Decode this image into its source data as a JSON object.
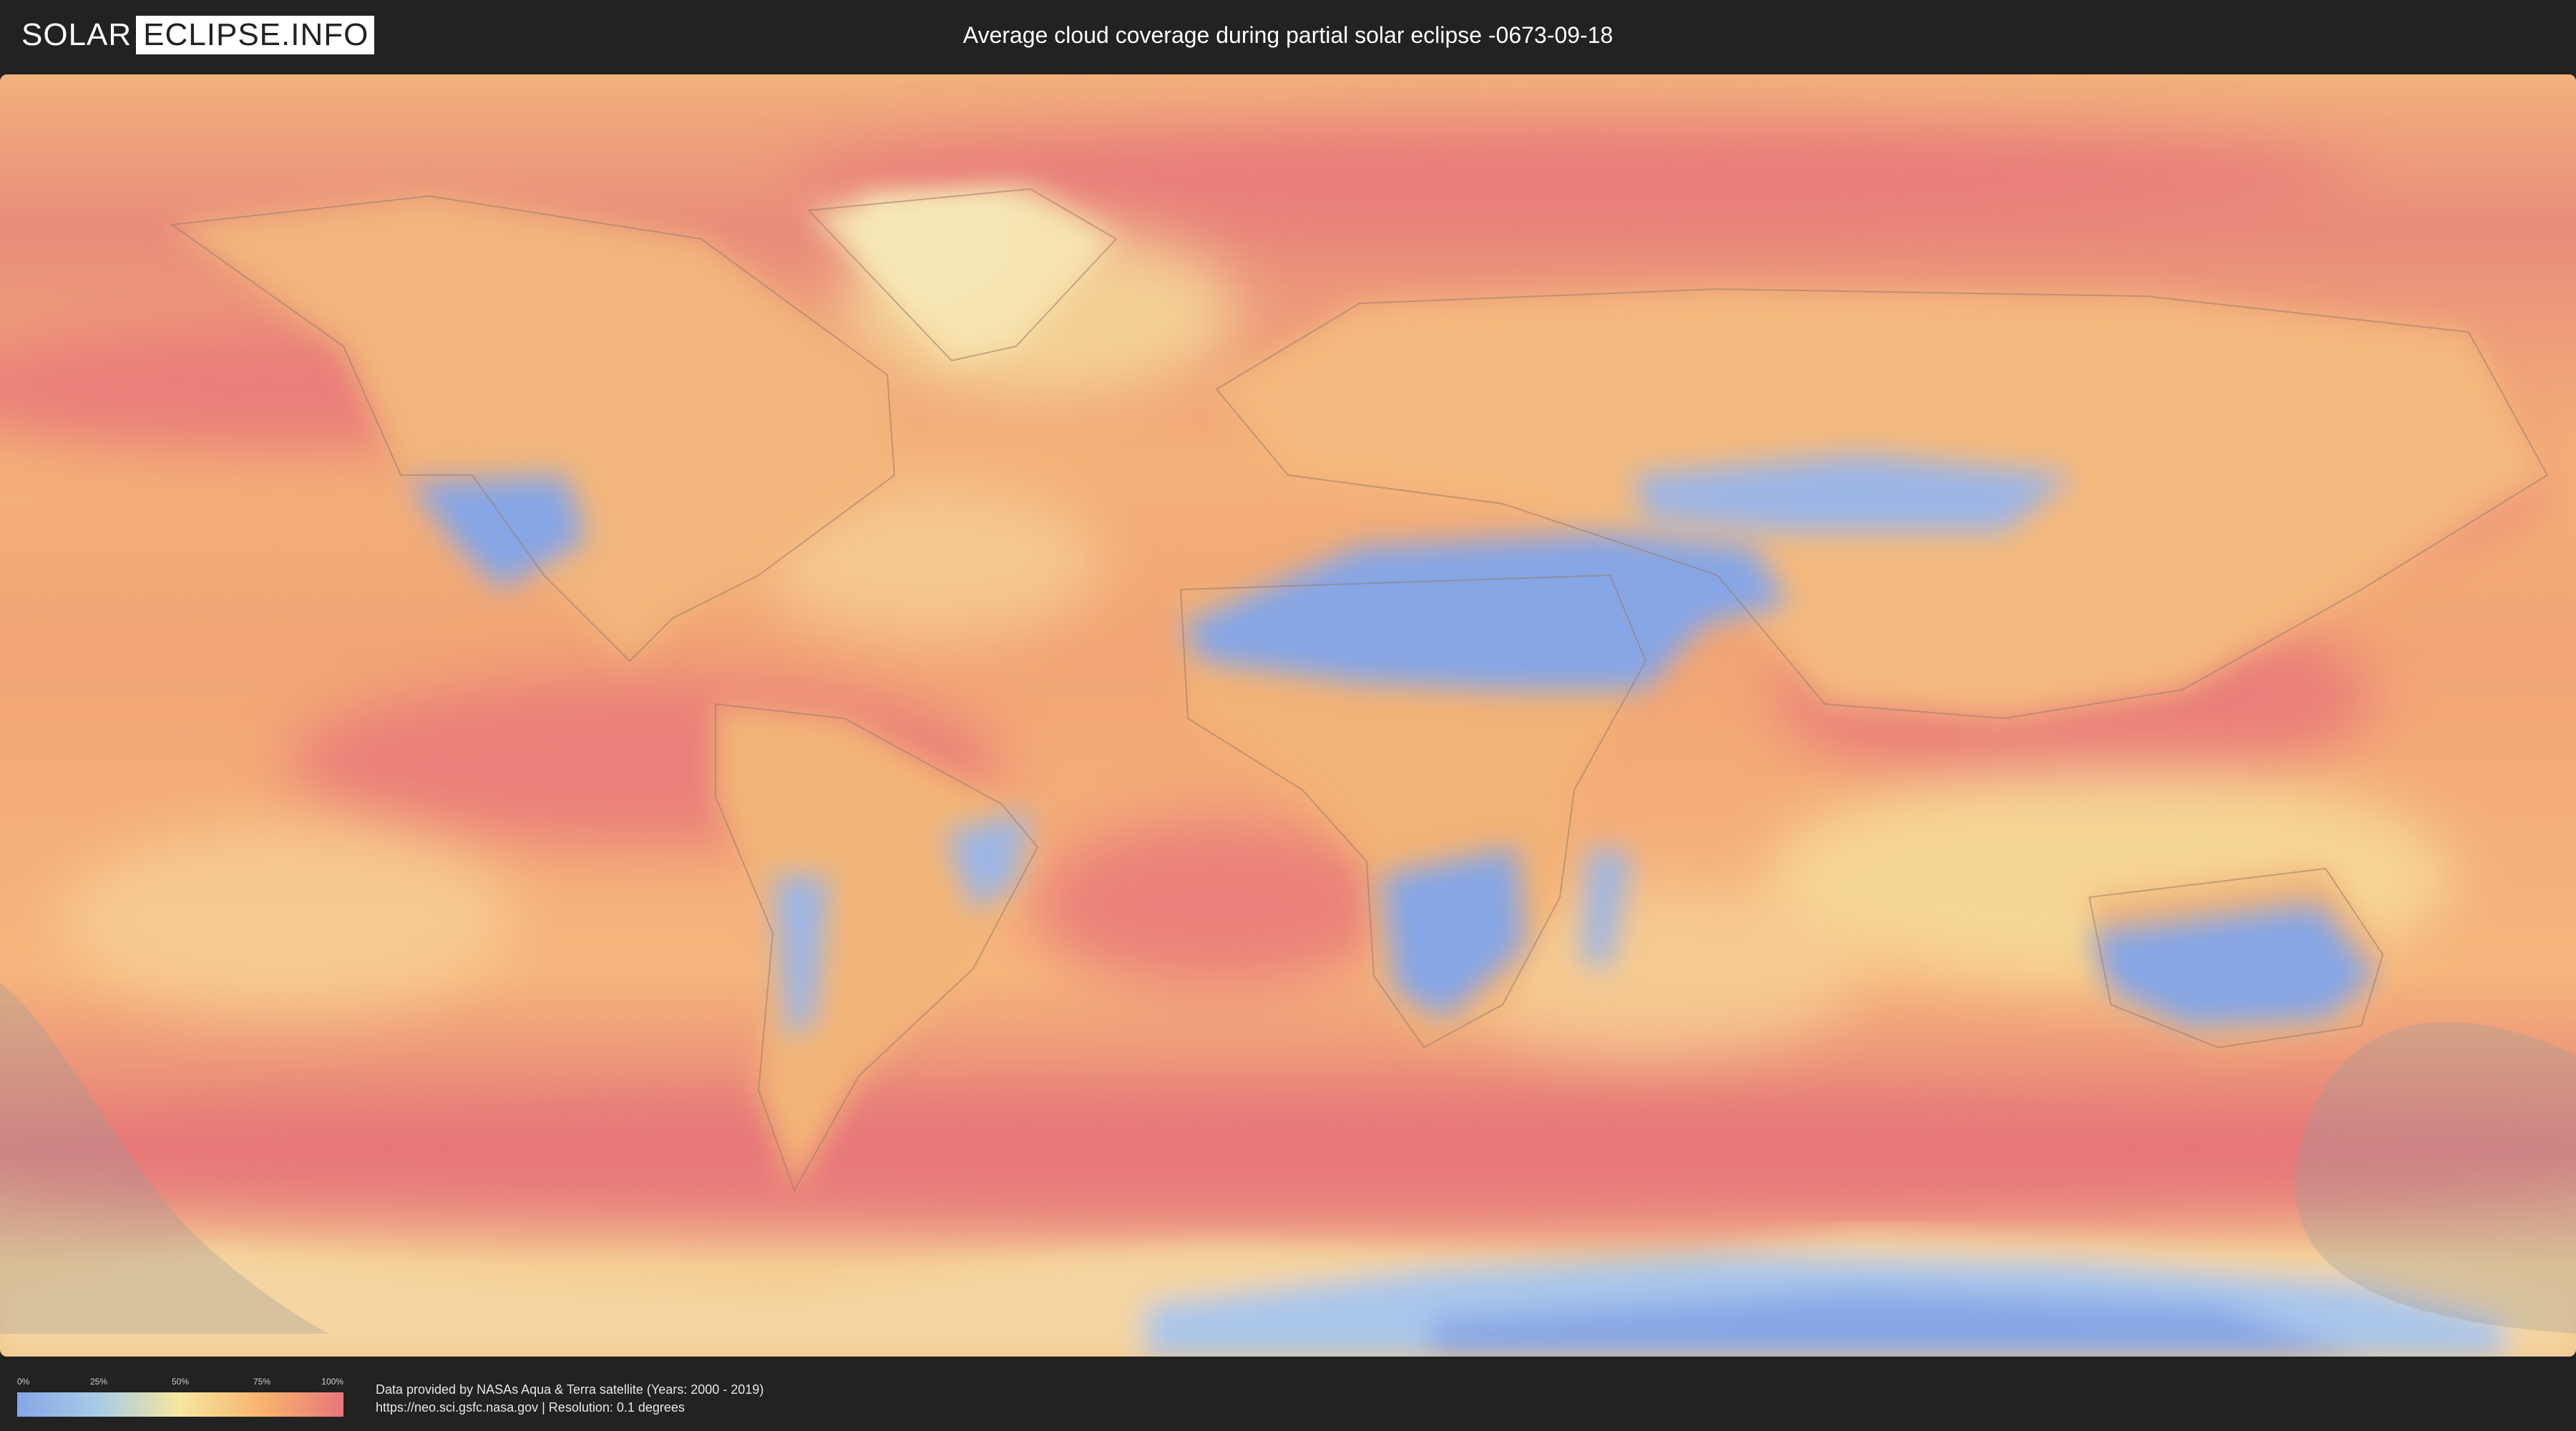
{
  "header": {
    "logo_part1": "SOLAR",
    "logo_part2": "ECLIPSE.INFO",
    "title": "Average cloud coverage during partial solar eclipse -0673-09-18"
  },
  "map": {
    "description_colors": {
      "clear": "#86a6e6",
      "low": "#a9cce6",
      "mid": "#f6e6a0",
      "high": "#f7b46e",
      "overcast": "#e8767a"
    },
    "eclipse_shadow_color": "#9a9a9a"
  },
  "legend": {
    "ticks": [
      "0%",
      "25%",
      "50%",
      "75%",
      "100%"
    ]
  },
  "footer": {
    "credit_line1": "Data provided by NASAs Aqua & Terra satellite (Years: 2000 - 2019)",
    "credit_line2": "https://neo.sci.gsfc.nasa.gov | Resolution: 0.1 degrees"
  }
}
